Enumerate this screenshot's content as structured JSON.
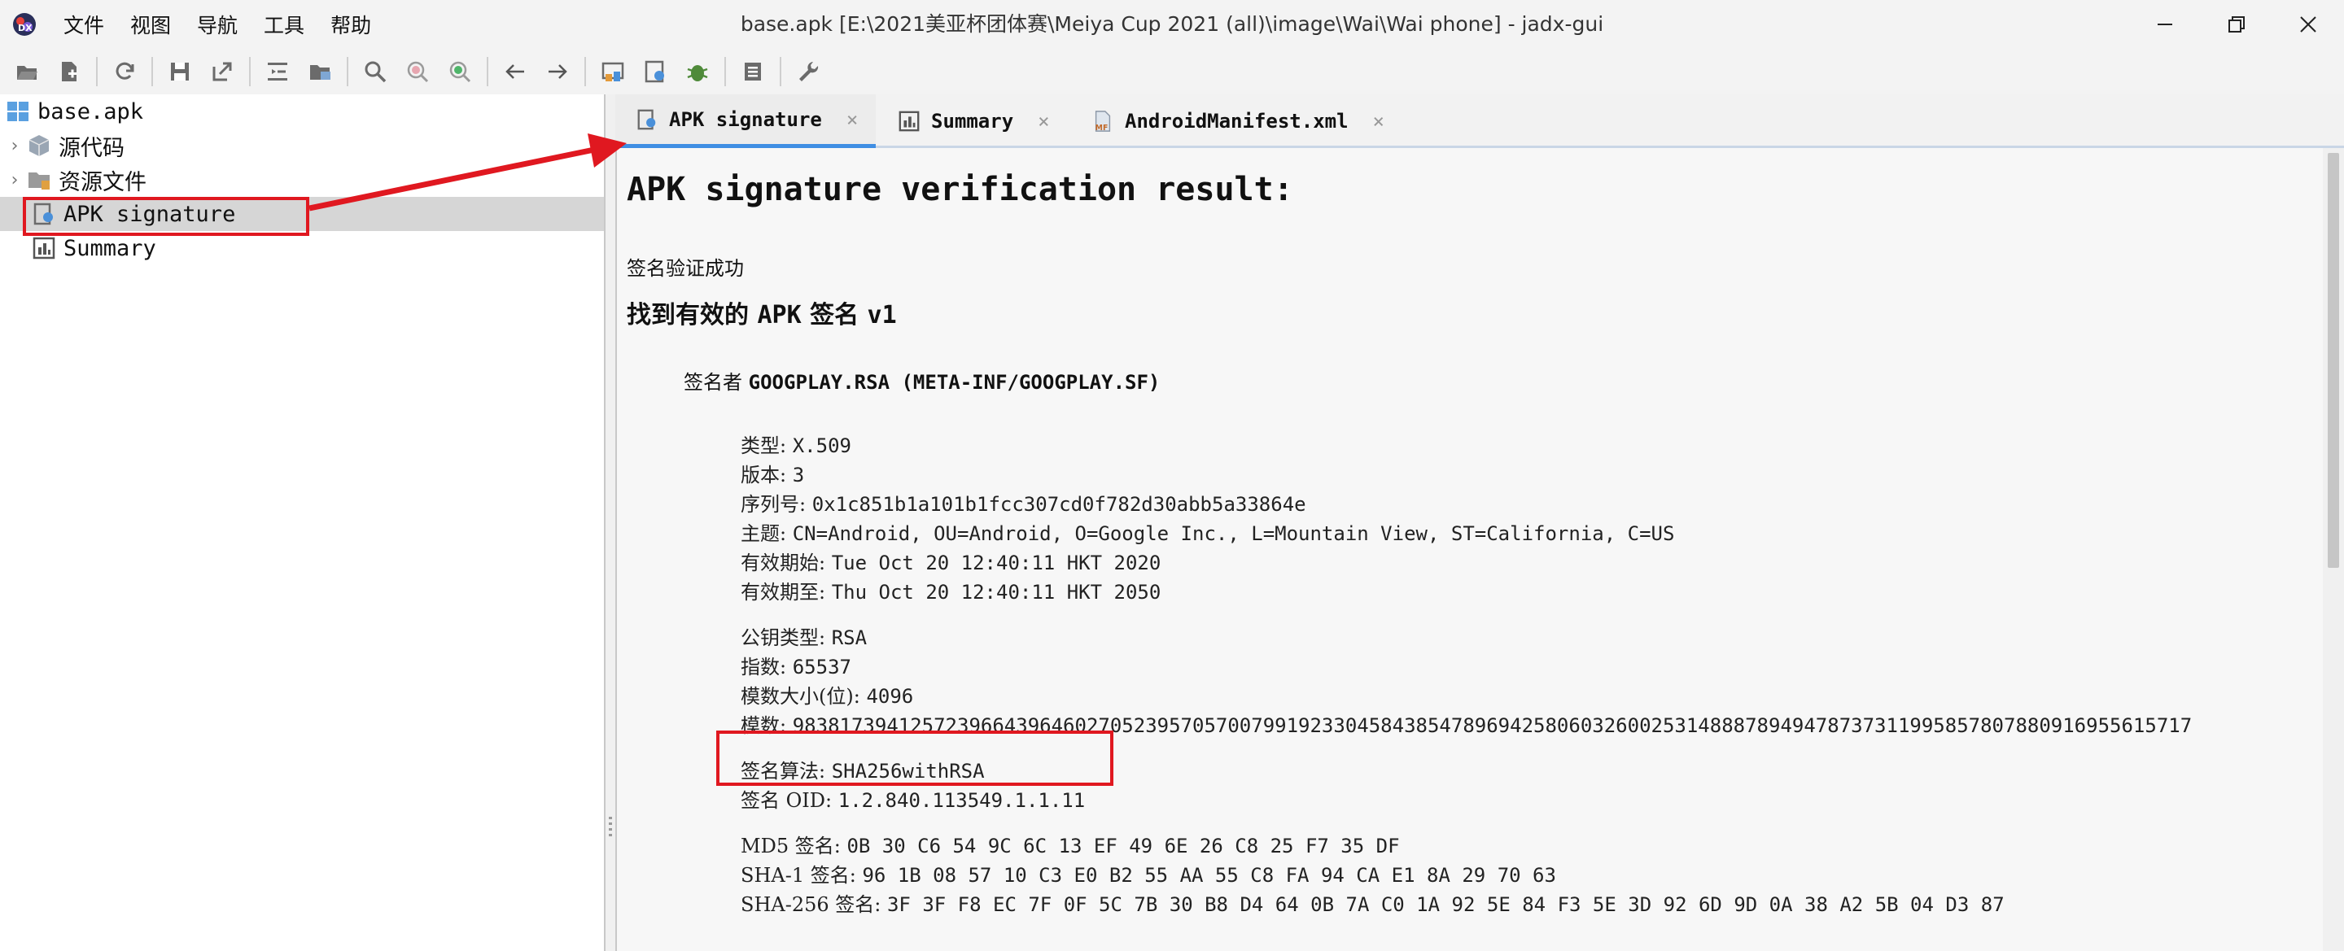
{
  "window": {
    "title": "base.apk [E:\\2021美亚杯团体赛\\Meiya Cup 2021 (all)\\image\\Wai\\Wai phone] - jadx-gui"
  },
  "menu": [
    "文件",
    "视图",
    "导航",
    "工具",
    "帮助"
  ],
  "toolbar_icons": [
    "open-file-icon",
    "add-files-icon",
    "sync-icon",
    "save-all-icon",
    "export-icon",
    "expand-tree-icon",
    "sync-tree-icon",
    "search-icon",
    "text-search-icon",
    "class-search-icon",
    "back-icon",
    "forward-icon",
    "deobfuscation-icon",
    "log-viewer-icon",
    "debug-icon",
    "list-icon",
    "preferences-icon"
  ],
  "tree": {
    "root": "base.apk",
    "items": [
      "源代码",
      "资源文件",
      "APK signature",
      "Summary"
    ]
  },
  "tabs": [
    {
      "label": "APK signature",
      "active": true
    },
    {
      "label": "Summary",
      "active": false
    },
    {
      "label": "AndroidManifest.xml",
      "active": false
    }
  ],
  "content": {
    "heading": "APK signature verification result:",
    "status": "签名验证成功",
    "found_prefix": "找到有效的",
    "found_apk": "APK",
    "found_mid": "签名",
    "found_ver": "v1",
    "signer_label": "签名者",
    "signer_value": "GOOGPLAY.RSA (META-INF/GOOGPLAY.SF)",
    "fields": [
      {
        "label": "类型: ",
        "value": "X.509"
      },
      {
        "label": "版本: ",
        "value": "3"
      },
      {
        "label": "序列号: ",
        "value": "0x1c851b1a101b1fcc307cd0f782d30abb5a33864e"
      },
      {
        "label": "主题: ",
        "value": "CN=Android, OU=Android, O=Google Inc., L=Mountain View, ST=California, C=US"
      },
      {
        "label": "有效期始: ",
        "value": "Tue Oct 20 12:40:11 HKT 2020"
      },
      {
        "label": "有效期至: ",
        "value": "Thu Oct 20 12:40:11 HKT 2050"
      },
      {
        "label": "公钥类型: ",
        "value": "RSA"
      },
      {
        "label": "指数: ",
        "value": "65537"
      },
      {
        "label": "模数大小(位): ",
        "value": "4096"
      },
      {
        "label": "模数: ",
        "value": "98381739412572396643964602705239570570079919233045843854789694258060326002531488878949478737311995857807880916955615717"
      },
      {
        "label": "签名算法: ",
        "value": "SHA256withRSA"
      },
      {
        "label": "签名 OID: ",
        "value": "1.2.840.113549.1.1.11"
      },
      {
        "label": "MD5 签名: ",
        "value": "0B 30 C6 54 9C 6C 13 EF 49 6E 26 C8 25 F7 35 DF"
      },
      {
        "label": "SHA-1 签名: ",
        "value": "96 1B 08 57 10 C3 E0 B2 55 AA 55 C8 FA 94 CA E1 8A 29 70 63"
      },
      {
        "label": "SHA-256 签名: ",
        "value": "3F 3F F8 EC 7F 0F 5C 7B 30 B8 D4 64 0B 7A C0 1A 92 5E 84 F3 5E 3D 92 6D 9D 0A 38 A2 5B 04 D3 87"
      }
    ]
  },
  "colors": {
    "accent": "#3f8ee3",
    "annotation": "#e01820",
    "selection": "#d6d6d6"
  }
}
